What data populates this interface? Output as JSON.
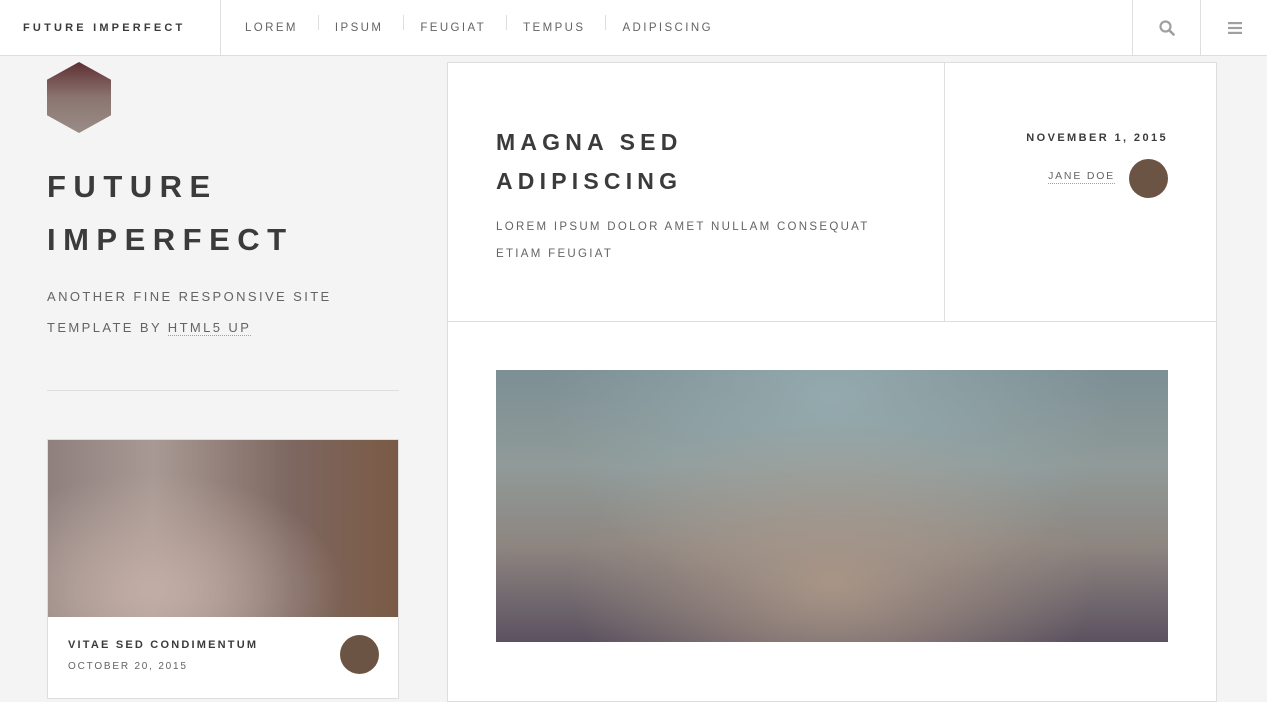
{
  "header": {
    "brand": "FUTURE IMPERFECT",
    "nav": [
      "LOREM",
      "IPSUM",
      "FEUGIAT",
      "TEMPUS",
      "ADIPISCING"
    ],
    "tools": {
      "search_icon": "search-icon",
      "menu_icon": "hamburger-menu-icon"
    }
  },
  "sidebar": {
    "title_line1": "FUTURE",
    "title_line2": "IMPERFECT",
    "tagline_text": "ANOTHER FINE RESPONSIVE SITE TEMPLATE BY",
    "tagline_link": "HTML5 UP",
    "mini_post": {
      "title": "VITAE SED CONDIMENTUM",
      "date": "OCTOBER 20, 2015"
    }
  },
  "post": {
    "title_line1": "MAGNA SED",
    "title_line2": "ADIPISCING",
    "subtitle": "LOREM IPSUM DOLOR AMET NULLAM CONSEQUAT ETIAM FEUGIAT",
    "date": "NOVEMBER 1, 2015",
    "author": "JANE DOE"
  },
  "colors": {
    "text": "#3c3b3b",
    "muted": "#646464",
    "border": "#dedede",
    "background": "#f4f4f4",
    "avatar": "#6b5443"
  }
}
